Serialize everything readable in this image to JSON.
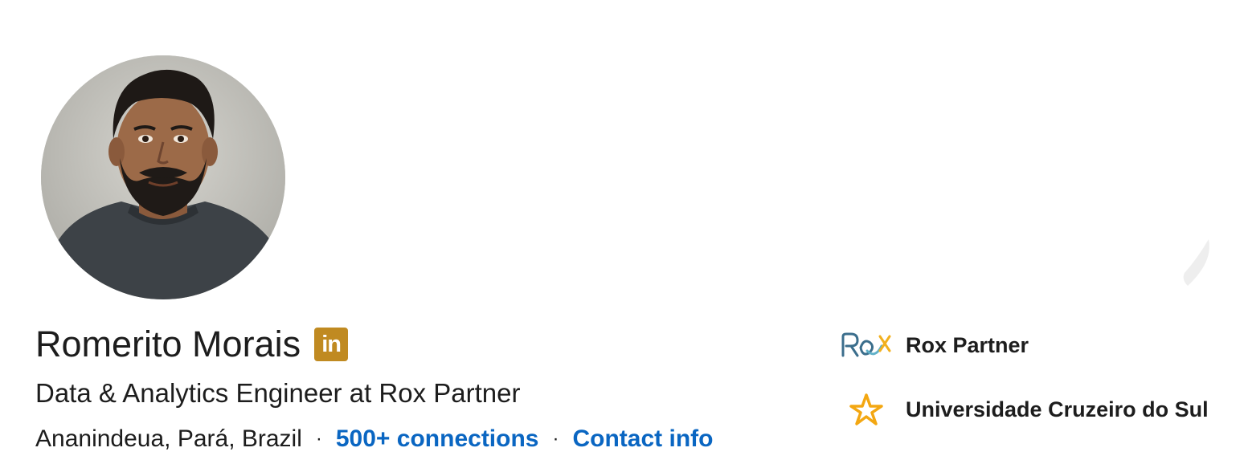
{
  "profile": {
    "name": "Romerito Morais",
    "headline": "Data & Analytics Engineer at Rox Partner",
    "location": "Ananindeua, Pará, Brazil",
    "separator": "·",
    "connections_label": "500+ connections",
    "contact_label": "Contact info",
    "premium_badge": "in",
    "avatar_icon": "profile-photo"
  },
  "organizations": [
    {
      "name": "Rox Partner",
      "logo_text": "ROX",
      "logo_icon": "rox-logo"
    },
    {
      "name": "Universidade Cruzeiro do Sul",
      "logo_icon": "star-logo"
    }
  ],
  "colors": {
    "link": "#0a66c2",
    "premium_badge": "#c08a21",
    "text": "#1d1d1d",
    "rox_logo_primary": "#3b6e8c",
    "rox_logo_accent": "#f2b01e",
    "star_logo": "#f3a712"
  }
}
